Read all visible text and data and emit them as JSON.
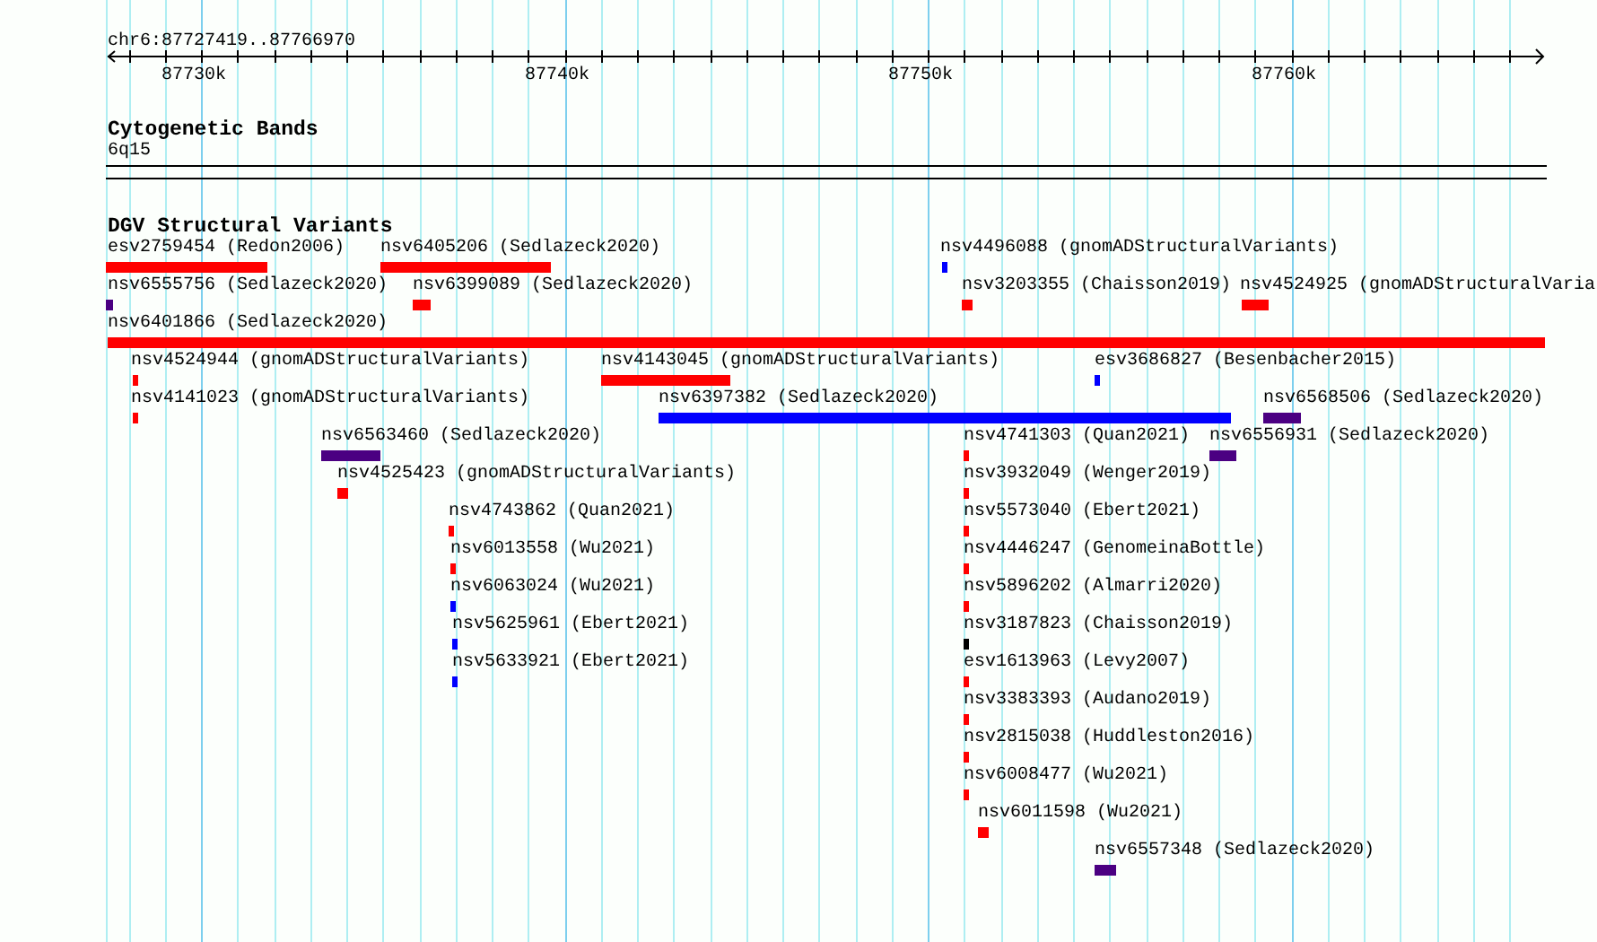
{
  "ruler": {
    "title": "chr6:87727419..87766970",
    "tick_labels": [
      "87730k",
      "87740k",
      "87750k",
      "87760k"
    ]
  },
  "tracks": [
    {
      "title": "Cytogenetic Bands",
      "kind": "bands",
      "bands": [
        "6q15"
      ]
    },
    {
      "title": "DGV Structural Variants",
      "kind": "features",
      "features": [
        {
          "label": "esv2759454 (Redon2006)",
          "color": "#ff0000"
        },
        {
          "label": "nsv6405206 (Sedlazeck2020)",
          "color": "#ff0000"
        },
        {
          "label": "nsv4496088 (gnomADStructuralVariants)",
          "color": "#0000ff"
        },
        {
          "label": "nsv6555756 (Sedlazeck2020)",
          "color": "#4b0082"
        },
        {
          "label": "nsv6399089 (Sedlazeck2020)",
          "color": "#ff0000"
        },
        {
          "label": "nsv3203355 (Chaisson2019)",
          "color": "#ff0000"
        },
        {
          "label": "nsv4524925 (gnomADStructuralVaria",
          "color": "#ff0000"
        },
        {
          "label": "nsv6401866 (Sedlazeck2020)",
          "color": "#ff0000"
        },
        {
          "label": "nsv4524944 (gnomADStructuralVariants)",
          "color": "#ff0000"
        },
        {
          "label": "nsv4143045 (gnomADStructuralVariants)",
          "color": "#ff0000"
        },
        {
          "label": "esv3686827 (Besenbacher2015)",
          "color": "#0000ff"
        },
        {
          "label": "nsv4141023 (gnomADStructuralVariants)",
          "color": "#ff0000"
        },
        {
          "label": "nsv6397382 (Sedlazeck2020)",
          "color": "#0000ff"
        },
        {
          "label": "nsv6568506 (Sedlazeck2020)",
          "color": "#4b0082"
        },
        {
          "label": "nsv6563460 (Sedlazeck2020)",
          "color": "#4b0082"
        },
        {
          "label": "nsv4741303 (Quan2021)",
          "color": "#ff0000"
        },
        {
          "label": "nsv6556931 (Sedlazeck2020)",
          "color": "#4b0082"
        },
        {
          "label": "nsv4525423 (gnomADStructuralVariants)",
          "color": "#ff0000"
        },
        {
          "label": "nsv3932049 (Wenger2019)",
          "color": "#ff0000"
        },
        {
          "label": "nsv4743862 (Quan2021)",
          "color": "#ff0000"
        },
        {
          "label": "nsv5573040 (Ebert2021)",
          "color": "#ff0000"
        },
        {
          "label": "nsv6013558 (Wu2021)",
          "color": "#ff0000"
        },
        {
          "label": "nsv4446247 (GenomeinaBottle)",
          "color": "#ff0000"
        },
        {
          "label": "nsv6063024 (Wu2021)",
          "color": "#0000ff"
        },
        {
          "label": "nsv5896202 (Almarri2020)",
          "color": "#ff0000"
        },
        {
          "label": "nsv5625961 (Ebert2021)",
          "color": "#0000ff"
        },
        {
          "label": "nsv3187823 (Chaisson2019)",
          "color": "#000000"
        },
        {
          "label": "nsv5633921 (Ebert2021)",
          "color": "#0000ff"
        },
        {
          "label": "esv1613963 (Levy2007)",
          "color": "#ff0000"
        },
        {
          "label": "nsv3383393 (Audano2019)",
          "color": "#ff0000"
        },
        {
          "label": "nsv2815038 (Huddleston2016)",
          "color": "#ff0000"
        },
        {
          "label": "nsv6008477 (Wu2021)",
          "color": "#ff0000"
        },
        {
          "label": "nsv6011598 (Wu2021)",
          "color": "#ff0000"
        },
        {
          "label": "nsv6557348 (Sedlazeck2020)",
          "color": "#4b0082"
        }
      ]
    }
  ]
}
